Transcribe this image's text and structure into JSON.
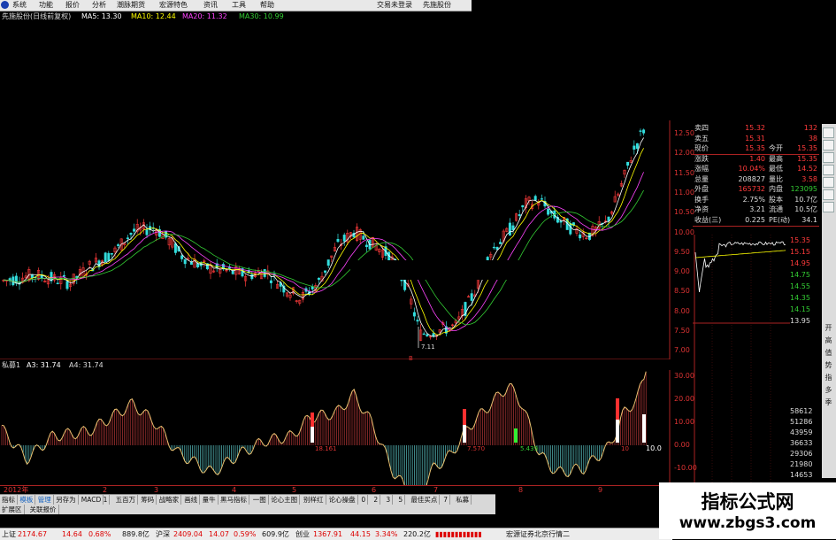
{
  "menu": {
    "items": [
      "系统",
      "功能",
      "报价",
      "分析",
      "潮脉期货",
      "宏源特色",
      "资讯",
      "工具",
      "帮助"
    ],
    "right_items": [
      "交易未登录",
      "先施股份"
    ]
  },
  "chart_header": {
    "title": "先施股份(日线前复权)",
    "ma5": "MA5: 13.30",
    "ma10": "MA10: 12.44",
    "ma20": "MA20: 11.32",
    "ma30": "MA30: 10.99"
  },
  "price_axis": [
    "12.50",
    "12.00",
    "11.50",
    "11.00",
    "10.50",
    "10.00",
    "9.50",
    "9.00",
    "8.50",
    "8.00",
    "7.50",
    "7.00"
  ],
  "price_annotation": "7.11",
  "indicator_header": {
    "name": "私募1",
    "a3": "A3: 31.74",
    "a4": "A4: 31.74"
  },
  "indicator_axis": [
    "30.00",
    "20.00",
    "10.00",
    "0.00",
    "-10.00"
  ],
  "indicator_labels": [
    "18.161",
    "7.570",
    "5.439",
    "10",
    "10.0"
  ],
  "date_axis": [
    "2012年",
    "2",
    "3",
    "4",
    "5",
    "6",
    "7",
    "8",
    "9"
  ],
  "quote_panel": {
    "rows": [
      {
        "l": "卖四",
        "v": "15.32",
        "r": "",
        "rv": "132"
      },
      {
        "l": "卖五",
        "v": "15.31",
        "r": "",
        "rv": "38"
      },
      {
        "l": "现价",
        "v": "15.35",
        "r": "今开",
        "rv": "15.35"
      },
      {
        "l": "涨跌",
        "v": "1.40",
        "r": "最高",
        "rv": "15.35"
      },
      {
        "l": "涨幅",
        "v": "10.04%",
        "r": "最低",
        "rv": "14.52"
      },
      {
        "l": "总量",
        "v": "208827",
        "r": "量比",
        "rv": "3.58"
      },
      {
        "l": "外盘",
        "v": "165732",
        "r": "内盘",
        "rv": "123095"
      },
      {
        "l": "换手",
        "v": "2.75%",
        "r": "股本",
        "rv": "10.7亿"
      },
      {
        "l": "净资",
        "v": "3.21",
        "r": "流通",
        "rv": "10.5亿"
      },
      {
        "l": "收益(三)",
        "v": "0.225",
        "r": "PE(动)",
        "rv": "34.1"
      }
    ]
  },
  "intraday_axis": [
    "15.35",
    "15.15",
    "14.95",
    "14.75",
    "14.55",
    "14.35",
    "14.15",
    "13.95"
  ],
  "volume_axis": [
    "58612",
    "51286",
    "43959",
    "36633",
    "29306",
    "21980",
    "14653"
  ],
  "side_tools": [
    "",
    "",
    "",
    "",
    "",
    "",
    "",
    "",
    "",
    "",
    "",
    "",
    "",
    "",
    "",
    "",
    "",
    "",
    "",
    "",
    "",
    "",
    "",
    "",
    "",
    "",
    "",
    "",
    "",
    "",
    "",
    "",
    "",
    ""
  ],
  "side_text": [
    "开",
    "高",
    "值",
    "势",
    "指",
    "多",
    "季"
  ],
  "tabs": [
    "指标",
    "模板",
    "管理",
    "另存为",
    "MACD",
    "1",
    "五百万",
    "筹码",
    "战略家",
    "画线",
    "量牛",
    "黑马指标",
    "一图",
    "论心主图",
    "别样红",
    "论心操盘",
    "0",
    "2",
    "3",
    "5",
    "最佳买点",
    "7",
    "私募"
  ],
  "tabs2": [
    "扩展区",
    "关联报价"
  ],
  "status": {
    "sh_label": "上证",
    "sh_value": "2174.67",
    "sh_change": "14.64",
    "sh_pct": "0.68%",
    "sh_amount": "889.8亿",
    "sz_label": "沪深",
    "sz_value": "2409.04",
    "sz_change": "14.07",
    "sz_pct": "0.59%",
    "sz_amount": "609.9亿",
    "cy_label": "创业",
    "cy_value": "1367.91",
    "cy_change": "44.15",
    "cy_pct": "3.34%",
    "cy_amount": "220.2亿",
    "broker": "宏源证券北京行情二"
  },
  "watermark": {
    "line1": "指标公式网",
    "line2": "www.zbgs3.com"
  },
  "colors": {
    "up": "#ff3b3b",
    "down": "#33dddd",
    "ma5": "#ffffff",
    "ma10": "#ffff00",
    "ma20": "#ff44ff",
    "ma30": "#33cc33",
    "axis": "#cc2222"
  }
}
